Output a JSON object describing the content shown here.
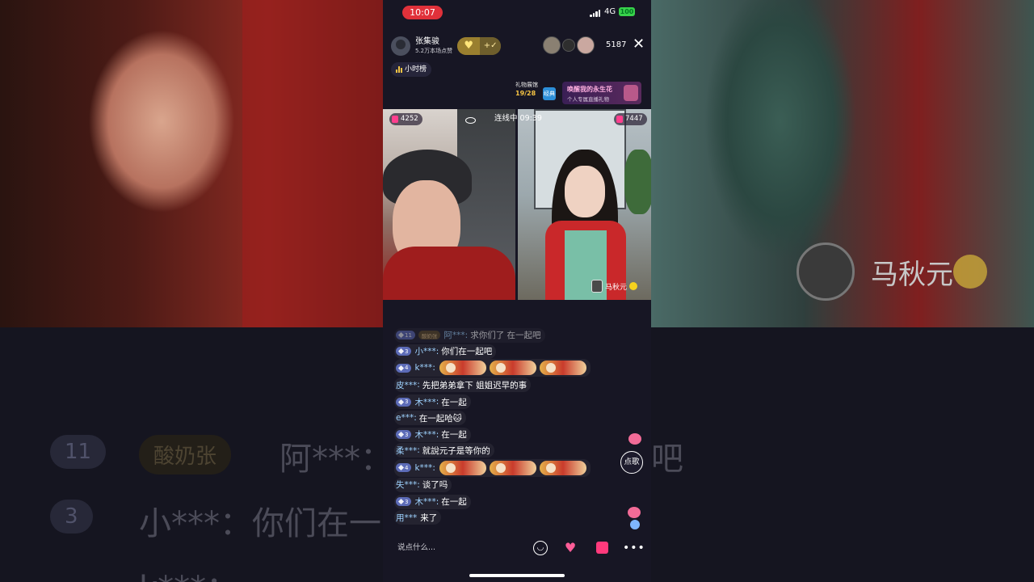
{
  "status": {
    "time": "10:07",
    "network": "4G",
    "battery": "100"
  },
  "host": {
    "name": "张集骏",
    "likes": "5.2万本场点赞",
    "follow": "+"
  },
  "viewers": {
    "count": "5187"
  },
  "rank": {
    "label": "小时榜"
  },
  "gift_gallery": {
    "label": "礼物展馆",
    "progress": "19/28",
    "icon_text": "经典"
  },
  "promo": {
    "title": "唤醒我的永生花",
    "subtitle": "个人专属直播礼物"
  },
  "video": {
    "left_score": "4252",
    "right_score": "7447",
    "link_status": "连线中 09:39",
    "guest_name": "马秋元"
  },
  "chat": [
    {
      "level": "11",
      "fanclub": "酸奶张",
      "user": "阿***",
      "text": "求你们了 在一起吧",
      "faded": true
    },
    {
      "level": "3",
      "user": "小***",
      "text": "你们在一起吧"
    },
    {
      "level": "4",
      "user": "k***",
      "text": "",
      "stickers": 3
    },
    {
      "level": "",
      "user": "皮***",
      "text": "先把弟弟拿下 姐姐迟早的事"
    },
    {
      "level": "3",
      "user": "木***",
      "text": "在一起"
    },
    {
      "level": "",
      "user": "e***",
      "text": "在一起哈🐱"
    },
    {
      "level": "3",
      "user": "木***",
      "text": "在一起"
    },
    {
      "level": "",
      "user": "柔***",
      "text": "就說元子是等你的"
    },
    {
      "level": "4",
      "user": "k***",
      "text": "",
      "stickers": 3
    },
    {
      "level": "",
      "user": "失***",
      "text": "谈了吗"
    },
    {
      "level": "3",
      "user": "木***",
      "text": "在一起"
    },
    {
      "level": "",
      "user": "用***",
      "text": "来了"
    }
  ],
  "song_button": "点歌",
  "input": {
    "placeholder": "说点什么..."
  },
  "background": {
    "left_pills": [
      "11",
      "酸奶张",
      "3"
    ],
    "left_text": [
      "阿***：",
      "小***：你们在一",
      "k***："
    ],
    "right_text": [
      "吧"
    ],
    "guest_name": "马秋元"
  },
  "colors": {
    "accent": "#e0313a",
    "username": "#9fd3ff",
    "level_badge": "#5c6bb7",
    "gift_pink": "#ff3a7c"
  }
}
